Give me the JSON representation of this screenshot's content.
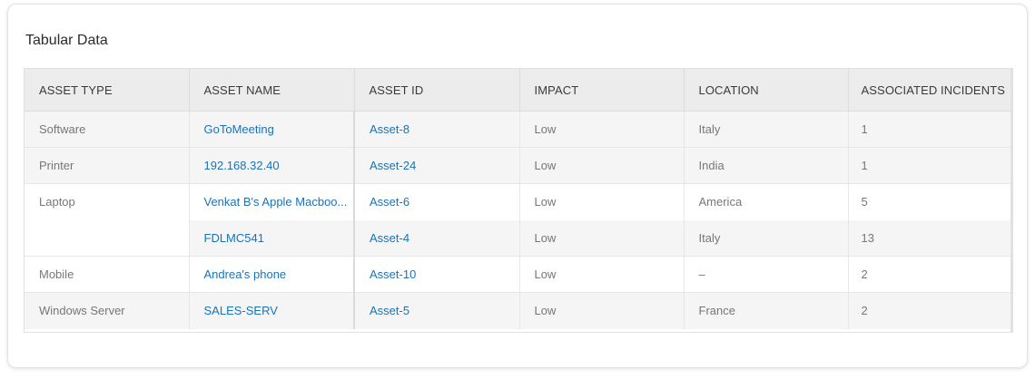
{
  "card": {
    "title": "Tabular Data"
  },
  "table": {
    "headers": [
      "ASSET TYPE",
      "ASSET NAME",
      "ASSET ID",
      "IMPACT",
      "LOCATION",
      "ASSOCIATED INCIDENTS"
    ],
    "groups": [
      {
        "asset_type": "Software",
        "rows": [
          {
            "asset_name": "GoToMeeting",
            "asset_id": "Asset-8",
            "impact": "Low",
            "location": "Italy",
            "incidents": "1"
          }
        ]
      },
      {
        "asset_type": "Printer",
        "rows": [
          {
            "asset_name": "192.168.32.40",
            "asset_id": "Asset-24",
            "impact": "Low",
            "location": "India",
            "incidents": "1"
          }
        ]
      },
      {
        "asset_type": "Laptop",
        "rows": [
          {
            "asset_name": "Venkat B's Apple Macboo...",
            "asset_id": "Asset-6",
            "impact": "Low",
            "location": "America",
            "incidents": "5"
          },
          {
            "asset_name": "FDLMC541",
            "asset_id": "Asset-4",
            "impact": "Low",
            "location": "Italy",
            "incidents": "13"
          }
        ]
      },
      {
        "asset_type": "Mobile",
        "rows": [
          {
            "asset_name": "Andrea's phone",
            "asset_id": "Asset-10",
            "impact": "Low",
            "location": "–",
            "incidents": "2"
          }
        ]
      },
      {
        "asset_type": "Windows Server",
        "rows": [
          {
            "asset_name": "SALES-SERV",
            "asset_id": "Asset-5",
            "impact": "Low",
            "location": "France",
            "incidents": "2"
          }
        ]
      }
    ]
  },
  "colors": {
    "link": "#1a73b8",
    "header_bg": "#ececec",
    "stripe_bg": "#f5f5f5"
  }
}
